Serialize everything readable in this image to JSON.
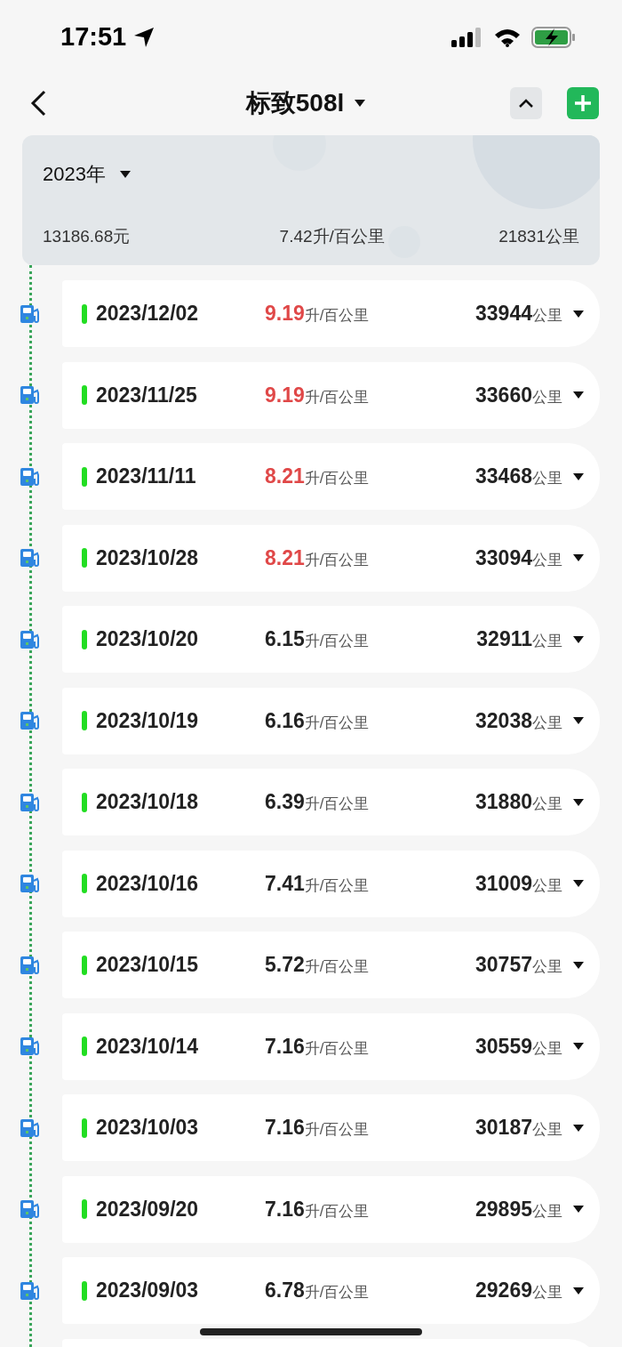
{
  "status_bar": {
    "time": "17:51"
  },
  "nav": {
    "title": "标致508l"
  },
  "summary": {
    "year": "2023年",
    "cost": "13186.68元",
    "consumption": "7.42升/百公里",
    "distance": "21831公里"
  },
  "records": [
    {
      "date": "2023/12/02",
      "consumption": "9.19",
      "consumption_unit": "升/百公里",
      "high": true,
      "mileage": "33944",
      "mileage_unit": "公里"
    },
    {
      "date": "2023/11/25",
      "consumption": "9.19",
      "consumption_unit": "升/百公里",
      "high": true,
      "mileage": "33660",
      "mileage_unit": "公里"
    },
    {
      "date": "2023/11/11",
      "consumption": "8.21",
      "consumption_unit": "升/百公里",
      "high": true,
      "mileage": "33468",
      "mileage_unit": "公里"
    },
    {
      "date": "2023/10/28",
      "consumption": "8.21",
      "consumption_unit": "升/百公里",
      "high": true,
      "mileage": "33094",
      "mileage_unit": "公里"
    },
    {
      "date": "2023/10/20",
      "consumption": "6.15",
      "consumption_unit": "升/百公里",
      "high": false,
      "mileage": "32911",
      "mileage_unit": "公里"
    },
    {
      "date": "2023/10/19",
      "consumption": "6.16",
      "consumption_unit": "升/百公里",
      "high": false,
      "mileage": "32038",
      "mileage_unit": "公里"
    },
    {
      "date": "2023/10/18",
      "consumption": "6.39",
      "consumption_unit": "升/百公里",
      "high": false,
      "mileage": "31880",
      "mileage_unit": "公里"
    },
    {
      "date": "2023/10/16",
      "consumption": "7.41",
      "consumption_unit": "升/百公里",
      "high": false,
      "mileage": "31009",
      "mileage_unit": "公里"
    },
    {
      "date": "2023/10/15",
      "consumption": "5.72",
      "consumption_unit": "升/百公里",
      "high": false,
      "mileage": "30757",
      "mileage_unit": "公里"
    },
    {
      "date": "2023/10/14",
      "consumption": "7.16",
      "consumption_unit": "升/百公里",
      "high": false,
      "mileage": "30559",
      "mileage_unit": "公里"
    },
    {
      "date": "2023/10/03",
      "consumption": "7.16",
      "consumption_unit": "升/百公里",
      "high": false,
      "mileage": "30187",
      "mileage_unit": "公里"
    },
    {
      "date": "2023/09/20",
      "consumption": "7.16",
      "consumption_unit": "升/百公里",
      "high": false,
      "mileage": "29895",
      "mileage_unit": "公里"
    },
    {
      "date": "2023/09/03",
      "consumption": "6.78",
      "consumption_unit": "升/百公里",
      "high": false,
      "mileage": "29269",
      "mileage_unit": "公里"
    }
  ]
}
